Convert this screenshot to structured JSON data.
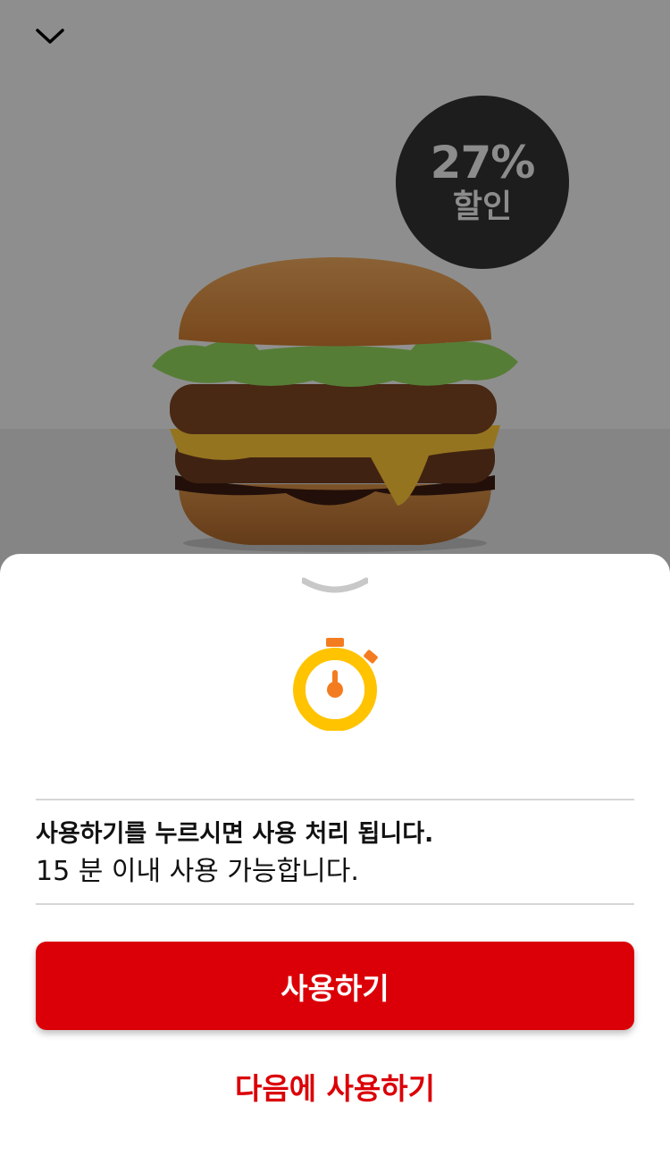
{
  "badge": {
    "percent": "27%",
    "label": "할인"
  },
  "product_image": {
    "name": "burger"
  },
  "message": {
    "line1": "사용하기를 누르시면 사용 처리 됩니다.",
    "line2": "15 분 이내 사용 가능합니다."
  },
  "buttons": {
    "use_label": "사용하기",
    "later_label": "다음에 사용하기"
  },
  "icons": {
    "close": "chevron-down-icon",
    "grabber": "sheet-handle-icon",
    "timer": "stopwatch-icon"
  },
  "colors": {
    "accent": "#db0007",
    "timer_ring": "#ffc300",
    "timer_hand": "#f47c20",
    "badge_bg": "#1d1d1d"
  }
}
